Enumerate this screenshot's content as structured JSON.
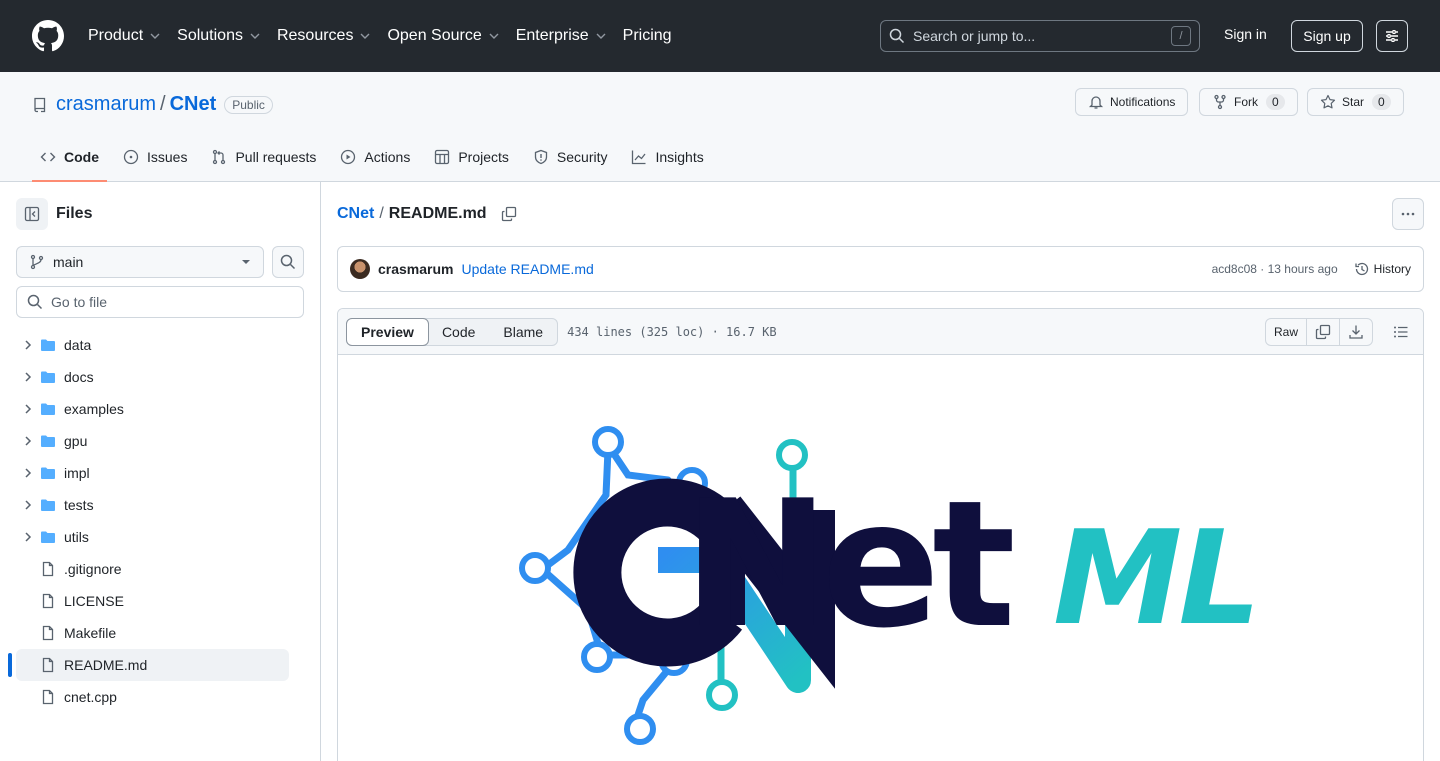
{
  "header": {
    "nav": [
      "Product",
      "Solutions",
      "Resources",
      "Open Source",
      "Enterprise",
      "Pricing"
    ],
    "search_placeholder": "Search or jump to...",
    "search_key": "/",
    "signin": "Sign in",
    "signup": "Sign up"
  },
  "repo": {
    "owner": "crasmarum",
    "separator": "/",
    "name": "CNet",
    "visibility": "Public",
    "notifications": "Notifications",
    "fork": {
      "label": "Fork",
      "count": "0"
    },
    "star": {
      "label": "Star",
      "count": "0"
    },
    "tabs": [
      "Code",
      "Issues",
      "Pull requests",
      "Actions",
      "Projects",
      "Security",
      "Insights"
    ]
  },
  "sidebar": {
    "title": "Files",
    "branch": "main",
    "goto_placeholder": "Go to file",
    "folders": [
      "data",
      "docs",
      "examples",
      "gpu",
      "impl",
      "tests",
      "utils"
    ],
    "files": [
      ".gitignore",
      "LICENSE",
      "Makefile",
      "README.md",
      "cnet.cpp"
    ],
    "selected": "README.md"
  },
  "content": {
    "crumb_root": "CNet",
    "crumb_sep": "/",
    "crumb_file": "README.md",
    "commit": {
      "author": "crasmarum",
      "message": "Update README.md",
      "meta": "acd8c08 · 13 hours ago",
      "history": "History"
    },
    "viewer": {
      "tabs": [
        "Preview",
        "Code",
        "Blame"
      ],
      "info": "434 lines (325 loc) · 16.7 KB",
      "raw": "Raw"
    },
    "logo": {
      "text": "Net",
      "accent": "ML"
    }
  },
  "colors": {
    "header_bg": "#24292f",
    "link": "#0969da",
    "folder": "#54aeff",
    "tab_underline": "#fd8c73",
    "logo_dark": "#0f0f3d",
    "logo_blue": "#2f8ef0",
    "logo_teal": "#22c1c3"
  }
}
